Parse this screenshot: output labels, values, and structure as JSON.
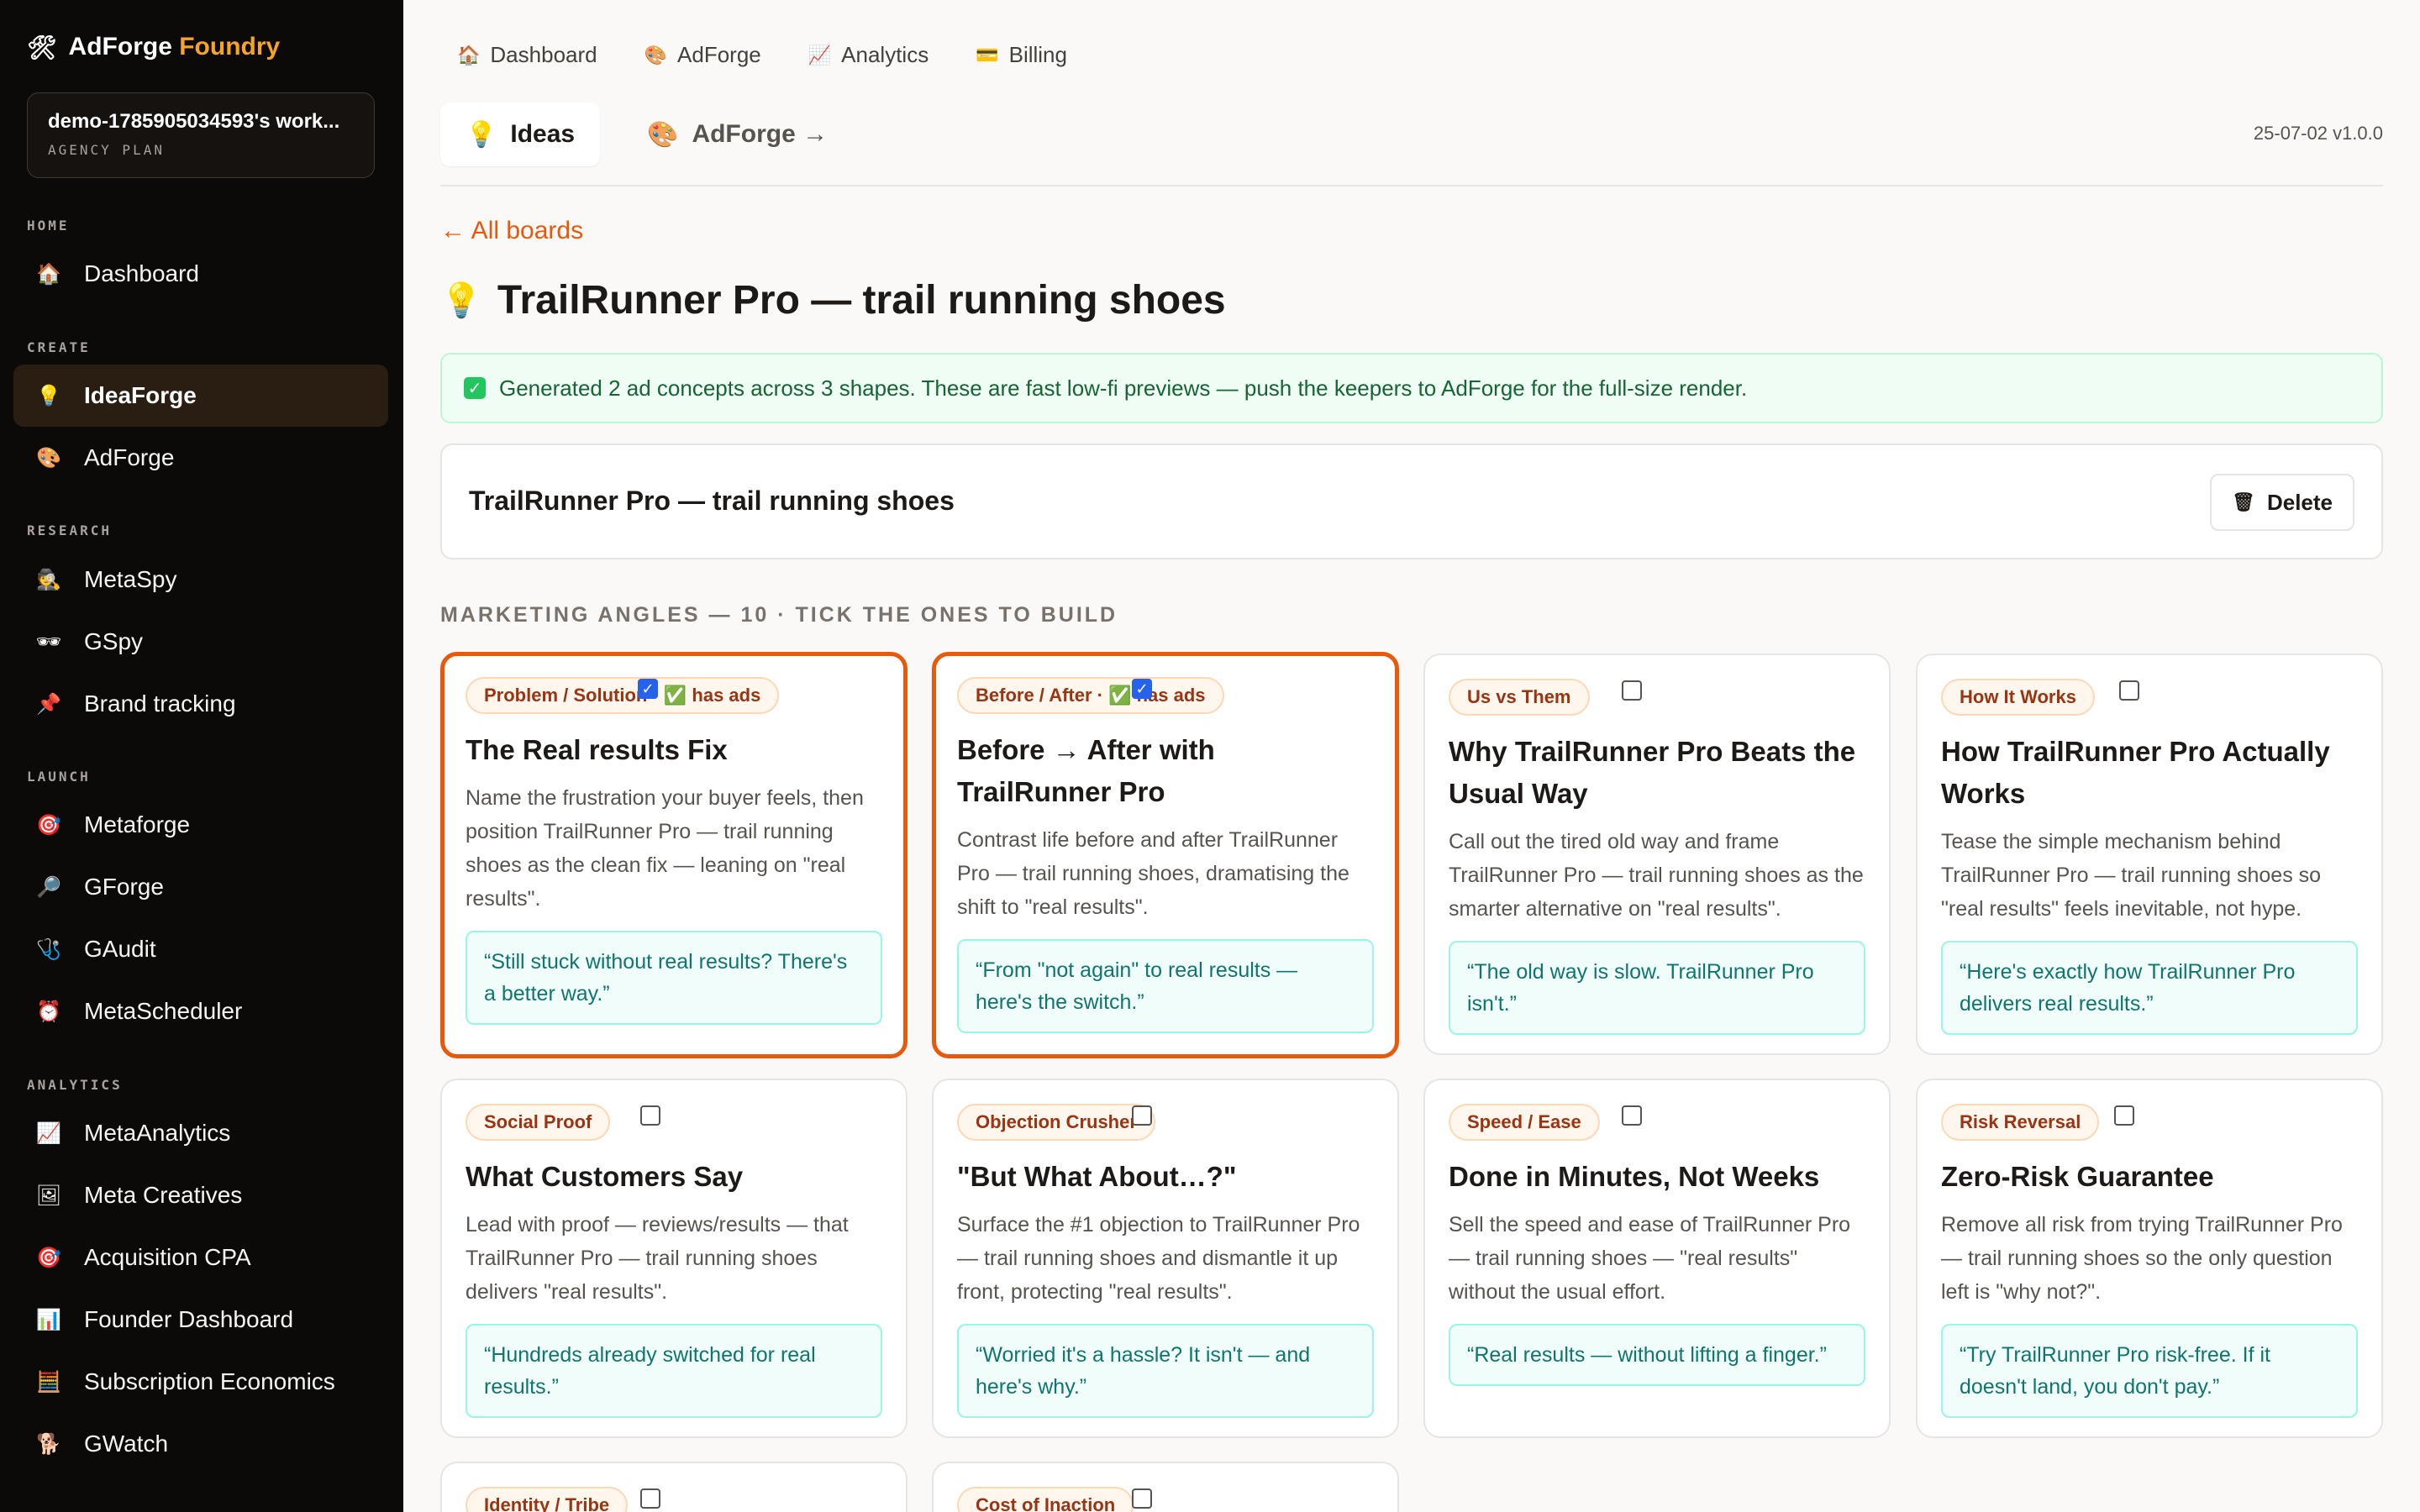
{
  "brand": {
    "icon": "hammer-wrench-icon",
    "name": "AdForge",
    "accent": "Foundry",
    "accent_color": "#f5a524"
  },
  "workspace": {
    "name": "demo-1785905034593's work...",
    "plan": "AGENCY PLAN"
  },
  "sidebar": {
    "sections": [
      {
        "label": "HOME",
        "items": [
          {
            "icon": "house-icon",
            "label": "Dashboard"
          }
        ]
      },
      {
        "label": "CREATE",
        "items": [
          {
            "icon": "lightbulb-icon",
            "label": "IdeaForge",
            "active": true
          },
          {
            "icon": "palette-icon",
            "label": "AdForge"
          }
        ]
      },
      {
        "label": "RESEARCH",
        "items": [
          {
            "icon": "spy-icon",
            "label": "MetaSpy"
          },
          {
            "icon": "sunglasses-icon",
            "label": "GSpy"
          },
          {
            "icon": "pushpin-icon",
            "label": "Brand tracking"
          }
        ]
      },
      {
        "label": "LAUNCH",
        "items": [
          {
            "icon": "target-icon",
            "label": "Metaforge"
          },
          {
            "icon": "magnifier-icon",
            "label": "GForge"
          },
          {
            "icon": "stethoscope-icon",
            "label": "GAudit"
          },
          {
            "icon": "alarm-clock-icon",
            "label": "MetaScheduler"
          }
        ]
      },
      {
        "label": "ANALYTICS",
        "items": [
          {
            "icon": "chart-up-icon",
            "label": "MetaAnalytics"
          },
          {
            "icon": "picture-icon",
            "label": "Meta Creatives"
          },
          {
            "icon": "target-icon",
            "label": "Acquisition CPA"
          },
          {
            "icon": "bar-chart-icon",
            "label": "Founder Dashboard"
          },
          {
            "icon": "abacus-icon",
            "label": "Subscription Economics"
          },
          {
            "icon": "dog-icon",
            "label": "GWatch"
          }
        ]
      }
    ]
  },
  "topnav": [
    {
      "icon": "house-icon",
      "label": "Dashboard"
    },
    {
      "icon": "palette-icon",
      "label": "AdForge"
    },
    {
      "icon": "chart-up-icon",
      "label": "Analytics"
    },
    {
      "icon": "credit-card-icon",
      "label": "Billing"
    }
  ],
  "subtabs": [
    {
      "icon": "lightbulb-icon",
      "label": "Ideas",
      "active": true
    },
    {
      "icon": "palette-icon",
      "label": "AdForge →"
    }
  ],
  "version": "25-07-02 v1.0.0",
  "back_link": "← All boards",
  "page_title": {
    "icon": "lightbulb-icon",
    "text": "TrailRunner Pro — trail running shoes"
  },
  "banner": {
    "icon": "check-icon",
    "text": "Generated 2 ad concepts across 3 shapes. These are fast low-fi previews — push the keepers to AdForge for the full-size render."
  },
  "board": {
    "name": "TrailRunner Pro — trail running shoes",
    "delete_icon": "trash-icon",
    "delete_label": "Delete"
  },
  "angles_label": "MARKETING ANGLES — 10 · TICK THE ONES TO BUILD",
  "accent_color": "#ea580c",
  "cards": [
    {
      "tag": "Problem / Solution · ✅ has ads",
      "checked": true,
      "selected": true,
      "title": "The Real results Fix",
      "desc": "Name the frustration your buyer feels, then position TrailRunner Pro — trail running shoes as the clean fix — leaning on \"real results\".",
      "quote": "“Still stuck without real results? There's a better way.”"
    },
    {
      "tag": "Before / After · ✅ has ads",
      "checked": true,
      "selected": true,
      "title": "Before → After with TrailRunner Pro",
      "desc": "Contrast life before and after TrailRunner Pro — trail running shoes, dramatising the shift to \"real results\".",
      "quote": "“From \"not again\" to real results — here's the switch.”"
    },
    {
      "tag": "Us vs Them",
      "checked": false,
      "selected": false,
      "title": "Why TrailRunner Pro Beats the Usual Way",
      "desc": "Call out the tired old way and frame TrailRunner Pro — trail running shoes as the smarter alternative on \"real results\".",
      "quote": "“The old way is slow. TrailRunner Pro isn't.”"
    },
    {
      "tag": "How It Works",
      "checked": false,
      "selected": false,
      "title": "How TrailRunner Pro Actually Works",
      "desc": "Tease the simple mechanism behind TrailRunner Pro — trail running shoes so \"real results\" feels inevitable, not hype.",
      "quote": "“Here's exactly how TrailRunner Pro delivers real results.”"
    },
    {
      "tag": "Social Proof",
      "checked": false,
      "selected": false,
      "title": "What Customers Say",
      "desc": "Lead with proof — reviews/results — that TrailRunner Pro — trail running shoes delivers \"real results\".",
      "quote": "“Hundreds already switched for real results.”"
    },
    {
      "tag": "Objection Crusher",
      "checked": false,
      "selected": false,
      "title": "\"But What About…?\"",
      "desc": "Surface the #1 objection to TrailRunner Pro — trail running shoes and dismantle it up front, protecting \"real results\".",
      "quote": "“Worried it's a hassle? It isn't — and here's why.”"
    },
    {
      "tag": "Speed / Ease",
      "checked": false,
      "selected": false,
      "title": "Done in Minutes, Not Weeks",
      "desc": "Sell the speed and ease of TrailRunner Pro — trail running shoes — \"real results\" without the usual effort.",
      "quote": "“Real results — without lifting a finger.”"
    },
    {
      "tag": "Risk Reversal",
      "checked": false,
      "selected": false,
      "title": "Zero-Risk Guarantee",
      "desc": "Remove all risk from trying TrailRunner Pro — trail running shoes so the only question left is \"why not?\".",
      "quote": "“Try TrailRunner Pro risk-free. If it doesn't land, you don't pay.”"
    },
    {
      "tag": "Identity / Tribe",
      "checked": false,
      "selected": false
    },
    {
      "tag": "Cost of Inaction",
      "checked": false,
      "selected": false
    }
  ]
}
